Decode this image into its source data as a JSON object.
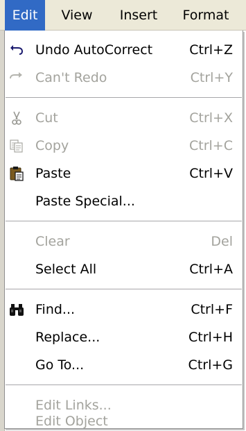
{
  "menubar": {
    "items": [
      {
        "label": "Edit",
        "active": true
      },
      {
        "label": "View",
        "active": false
      },
      {
        "label": "Insert",
        "active": false
      },
      {
        "label": "Format",
        "active": false
      }
    ]
  },
  "menu": {
    "items": [
      {
        "label": "Undo AutoCorrect",
        "shortcut": "Ctrl+Z",
        "icon": "undo-icon",
        "enabled": true
      },
      {
        "label": "Can't Redo",
        "shortcut": "Ctrl+Y",
        "icon": "redo-icon",
        "enabled": false
      },
      {
        "label": "Cut",
        "shortcut": "Ctrl+X",
        "icon": "scissors-icon",
        "enabled": false
      },
      {
        "label": "Copy",
        "shortcut": "Ctrl+C",
        "icon": "copy-icon",
        "enabled": false
      },
      {
        "label": "Paste",
        "shortcut": "Ctrl+V",
        "icon": "clipboard-icon",
        "enabled": true
      },
      {
        "label": "Paste Special...",
        "shortcut": "",
        "icon": "",
        "enabled": true
      },
      {
        "label": "Clear",
        "shortcut": "Del",
        "icon": "",
        "enabled": false
      },
      {
        "label": "Select All",
        "shortcut": "Ctrl+A",
        "icon": "",
        "enabled": true
      },
      {
        "label": "Find...",
        "shortcut": "Ctrl+F",
        "icon": "binoculars-icon",
        "enabled": true
      },
      {
        "label": "Replace...",
        "shortcut": "Ctrl+H",
        "icon": "",
        "enabled": true
      },
      {
        "label": "Go To...",
        "shortcut": "Ctrl+G",
        "icon": "",
        "enabled": true
      },
      {
        "label": "Edit Links...",
        "shortcut": "",
        "icon": "",
        "enabled": false
      },
      {
        "label": "Edit Object",
        "shortcut": "",
        "icon": "",
        "enabled": false
      }
    ]
  },
  "colors": {
    "menubar_bg": "#ece9d8",
    "highlight": "#316ac5",
    "disabled_text": "#a3a39d"
  }
}
